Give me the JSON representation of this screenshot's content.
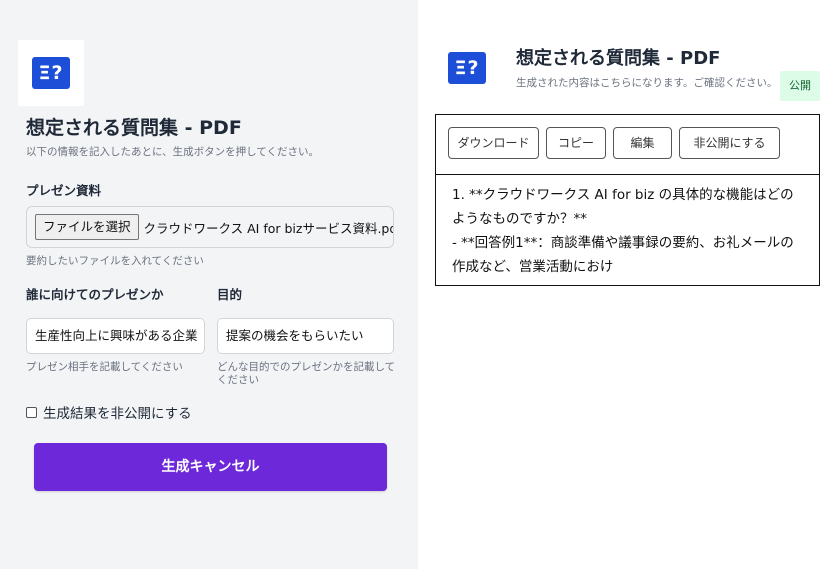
{
  "form": {
    "logo_text": "Ξ?",
    "title": "想定される質問集 - PDF",
    "subtitle": "以下の情報を記入したあとに、生成ボタンを押してください。",
    "presentation_label": "プレゼン資料",
    "file_button": "ファイルを選択",
    "file_name": "クラウドワークス AI for bizサービス資料.pdf",
    "file_help": "要約したいファイルを入れてください",
    "audience_label": "誰に向けてのプレゼンか",
    "audience_value": "生産性向上に興味がある企業",
    "audience_help": "プレゼン相手を記載してください",
    "purpose_label": "目的",
    "purpose_value": "提案の機会をもらいたい",
    "purpose_help": "どんな目的でのプレゼンかを記載してください",
    "private_label": "生成結果を非公開にする",
    "cancel_button": "生成キャンセル"
  },
  "result": {
    "logo_text": "Ξ?",
    "title": "想定される質問集 - PDF",
    "subtitle": "生成された内容はこちらになります。ご確認ください。",
    "public_badge": "公開",
    "toolbar": {
      "download": "ダウンロード",
      "copy": "コピー",
      "edit": "編集",
      "make_private": "非公開にする"
    },
    "line1": "1. **クラウドワークス AI for biz の具体的な機能はどのようなものですか？**",
    "line2": " - **回答例1**：商談準備や議事録の要約、お礼メールの作成など、営業活動におけ"
  },
  "colors": {
    "primary_button": "#6d28d9",
    "logo": "#1d4ed8",
    "badge_bg": "#dcfce7"
  }
}
